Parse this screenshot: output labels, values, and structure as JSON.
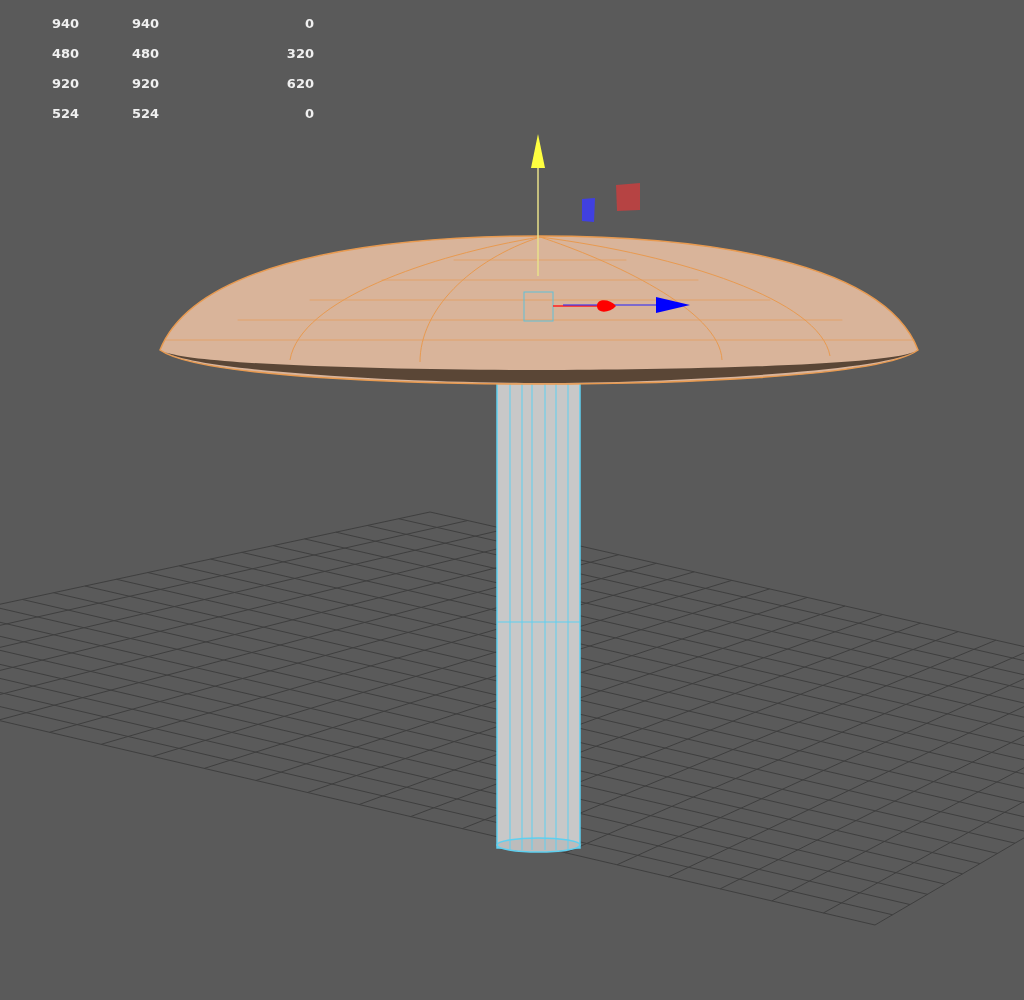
{
  "hud_stats": {
    "rows": [
      [
        "940",
        "940",
        "0"
      ],
      [
        "480",
        "480",
        "320"
      ],
      [
        "920",
        "920",
        "620"
      ],
      [
        "524",
        "524",
        "0"
      ]
    ]
  }
}
